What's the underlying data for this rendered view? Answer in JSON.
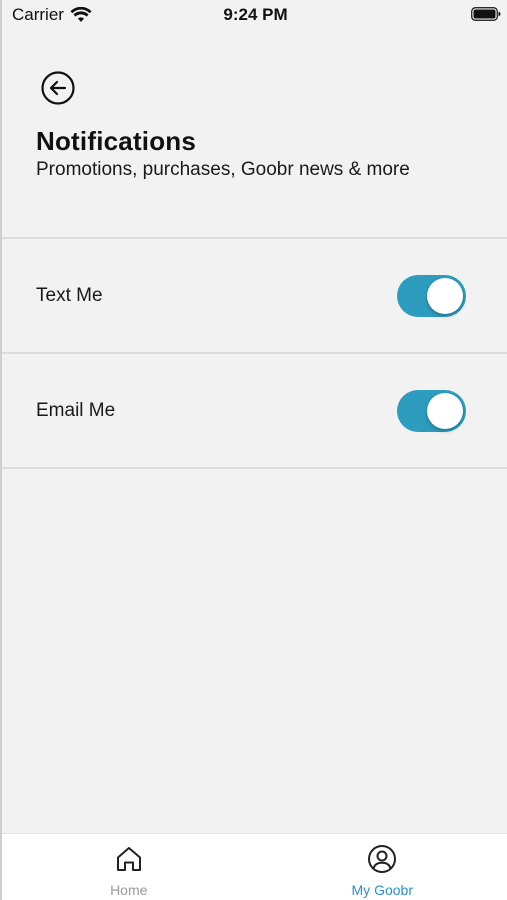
{
  "status_bar": {
    "carrier": "Carrier",
    "time": "9:24 PM",
    "wifi_icon": "wifi-icon",
    "battery_icon": "battery-icon"
  },
  "header": {
    "back_icon": "arrow-left-circle-icon",
    "title": "Notifications",
    "subtitle": "Promotions, purchases, Goobr news & more"
  },
  "settings": [
    {
      "label": "Text Me",
      "enabled": true
    },
    {
      "label": "Email Me",
      "enabled": true
    }
  ],
  "tab_bar": {
    "tabs": [
      {
        "label": "Home",
        "icon": "home-icon",
        "active": false
      },
      {
        "label": "My Goobr",
        "icon": "user-circle-icon",
        "active": true
      }
    ]
  },
  "colors": {
    "background": "#f2f2f2",
    "toggle_on": "#2e9cbf",
    "tab_active": "#2b8fd6",
    "tab_inactive": "#9a9a9a"
  }
}
